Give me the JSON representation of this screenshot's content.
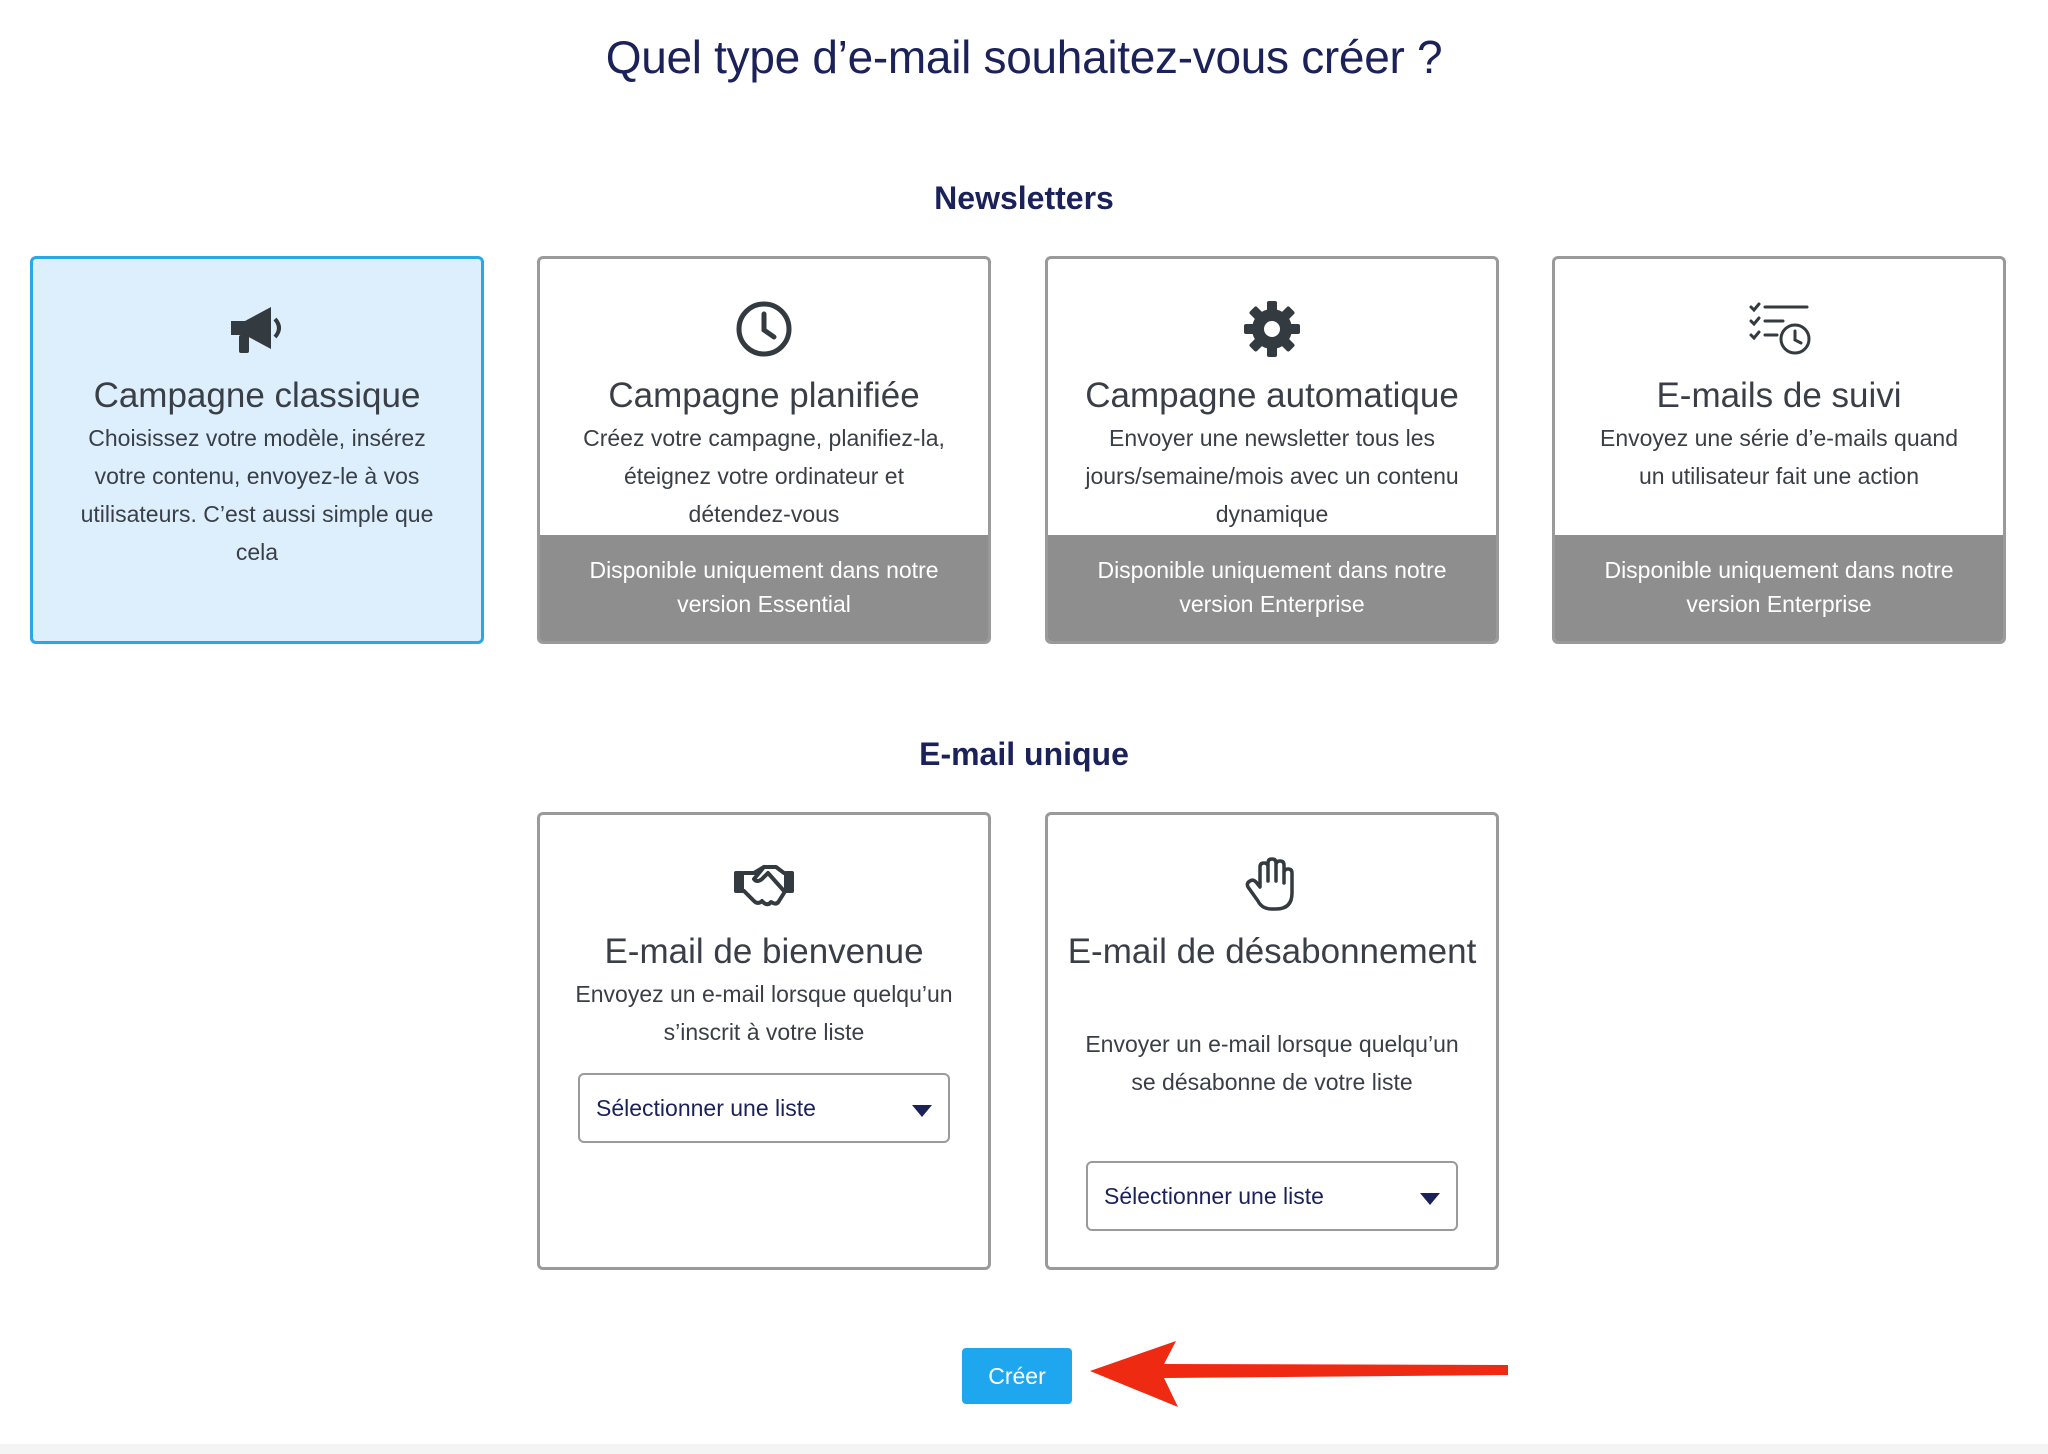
{
  "page": {
    "title": "Quel type d’e-mail souhaitez-vous créer ?"
  },
  "sections": {
    "newsletters": {
      "title": "Newsletters"
    },
    "single": {
      "title": "E-mail unique"
    }
  },
  "cards": {
    "classic": {
      "icon": "megaphone-icon",
      "title": "Campagne classique",
      "desc": "Choisissez votre modèle, insérez votre contenu, envoyez-le à vos utilisateurs. C’est aussi simple que cela",
      "selected": true
    },
    "scheduled": {
      "icon": "clock-icon",
      "title": "Campagne planifiée",
      "desc": "Créez votre campagne, planifiez-la, éteignez votre ordinateur et détendez-vous",
      "banner": "Disponible uniquement dans notre version Essential"
    },
    "automatic": {
      "icon": "gear-icon",
      "title": "Campagne automatique",
      "desc": "Envoyer une newsletter tous les jours/semaine/mois avec un contenu dynamique",
      "banner": "Disponible uniquement dans notre version Enterprise"
    },
    "followup": {
      "icon": "checklist-clock-icon",
      "title": "E-mails de suivi",
      "desc": "Envoyez une série d’e-mails quand un utilisateur fait une action",
      "banner": "Disponible uniquement dans notre version Enterprise"
    },
    "welcome": {
      "icon": "handshake-icon",
      "title": "E-mail de bienvenue",
      "desc": "Envoyez un e-mail lorsque quelqu’un s’inscrit à votre liste",
      "select": "Sélectionner une liste"
    },
    "unsubscribe": {
      "icon": "hand-icon",
      "title": "E-mail de désabonnement",
      "desc": "Envoyer un e-mail lorsque quelqu’un se désabonne de votre liste",
      "select": "Sélectionner une liste"
    }
  },
  "actions": {
    "create_label": "Créer"
  },
  "colors": {
    "title": "#1b2159",
    "selected_bg": "#ddeefc",
    "selected_border": "#2aa8e6",
    "banner": "#8e8e8e",
    "button": "#1ea7ef",
    "arrow": "#ee2a12"
  }
}
